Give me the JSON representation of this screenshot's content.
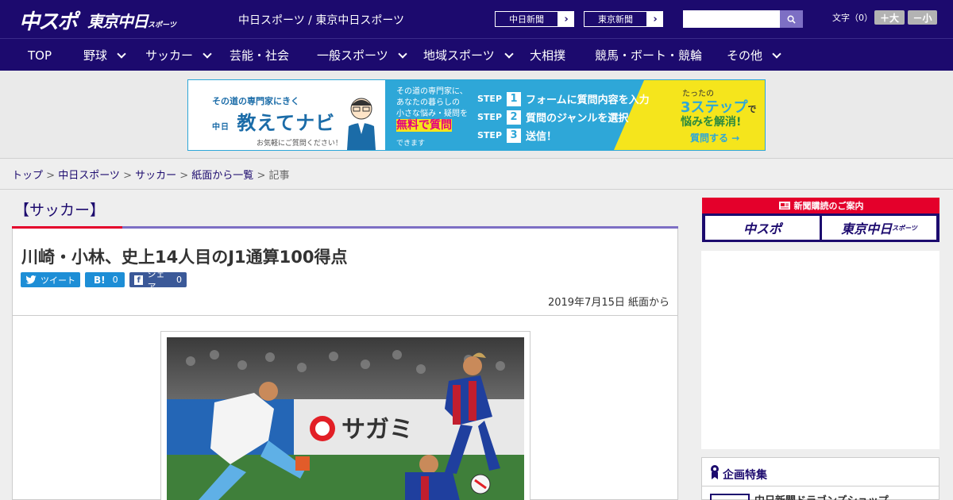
{
  "header": {
    "logo_main": "中スポ",
    "logo_tokyo": "東京中日",
    "logo_tokyo_sub": "スポーツ",
    "site_title": "中日スポーツ / 東京中日スポーツ",
    "paper_links": [
      {
        "label": "中日新聞"
      },
      {
        "label": "東京新聞"
      }
    ],
    "search_placeholder": "",
    "font_size_label": "文字（0）",
    "font_bigger": "＋大",
    "font_smaller": "－小"
  },
  "nav": {
    "items": [
      {
        "label": "TOP",
        "dropdown": false
      },
      {
        "label": "野球",
        "dropdown": true
      },
      {
        "label": "サッカー",
        "dropdown": true
      },
      {
        "label": "芸能・社会",
        "dropdown": false
      },
      {
        "label": "一般スポーツ",
        "dropdown": true
      },
      {
        "label": "地域スポーツ",
        "dropdown": true
      },
      {
        "label": "大相撲",
        "dropdown": false
      },
      {
        "label": "競馬・ボート・競輪",
        "dropdown": false
      },
      {
        "label": "その他",
        "dropdown": true
      }
    ]
  },
  "ad_banner": {
    "tagline": "その道の専門家にきく",
    "brand_prefix": "中日",
    "brand_name": "教えてナビ",
    "brand_note": "お気軽にご質問ください！",
    "desc_lines": [
      "その道の専門家に、",
      "あなたの暮らしの",
      "小さな悩み・疑問を"
    ],
    "desc_highlight": "無料で質問",
    "desc_end": "できます",
    "steps": [
      {
        "label": "STEP",
        "num": "1",
        "text": "フォームに質問内容を入力"
      },
      {
        "label": "STEP",
        "num": "2",
        "text": "質問のジャンルを選択"
      },
      {
        "label": "STEP",
        "num": "3",
        "text": "送信！"
      }
    ],
    "yellow_1": "たったの",
    "yellow_2": "3ステップ",
    "yellow_2b": "で",
    "yellow_3": "悩みを解消!",
    "cta": "質問する →"
  },
  "breadcrumb": {
    "items": [
      "トップ",
      "中日スポーツ",
      "サッカー",
      "紙面から一覧"
    ],
    "current": "記事",
    "sep": " > "
  },
  "article": {
    "category": "【サッカー】",
    "headline": "川崎・小林、史上14人目のJ1通算100得点",
    "share": {
      "tweet_label": "ツイート",
      "hatena_label": "B!",
      "hatena_count": "0",
      "fb_label": "シェア",
      "fb_count": "0"
    },
    "date": "2019年7月15日 紙面から",
    "photo_alt_text": "サガミ"
  },
  "sidebar": {
    "subscribe_head": "新聞購読のご案内",
    "subscribe_chuspo": "中スポ",
    "subscribe_tokyo": "東京中日",
    "subscribe_tokyo_sub": "スポーツ",
    "feature_title": "企画特集",
    "feature_item": "中日新聞ドラゴンズショップ"
  },
  "colors": {
    "brand_navy": "#1c0a6e",
    "accent_red": "#e4002b",
    "accent_purple": "#7d6fc4",
    "ad_blue": "#2ea7d8",
    "ad_yellow": "#f5e51c",
    "social_blue": "#1d8ed6"
  }
}
